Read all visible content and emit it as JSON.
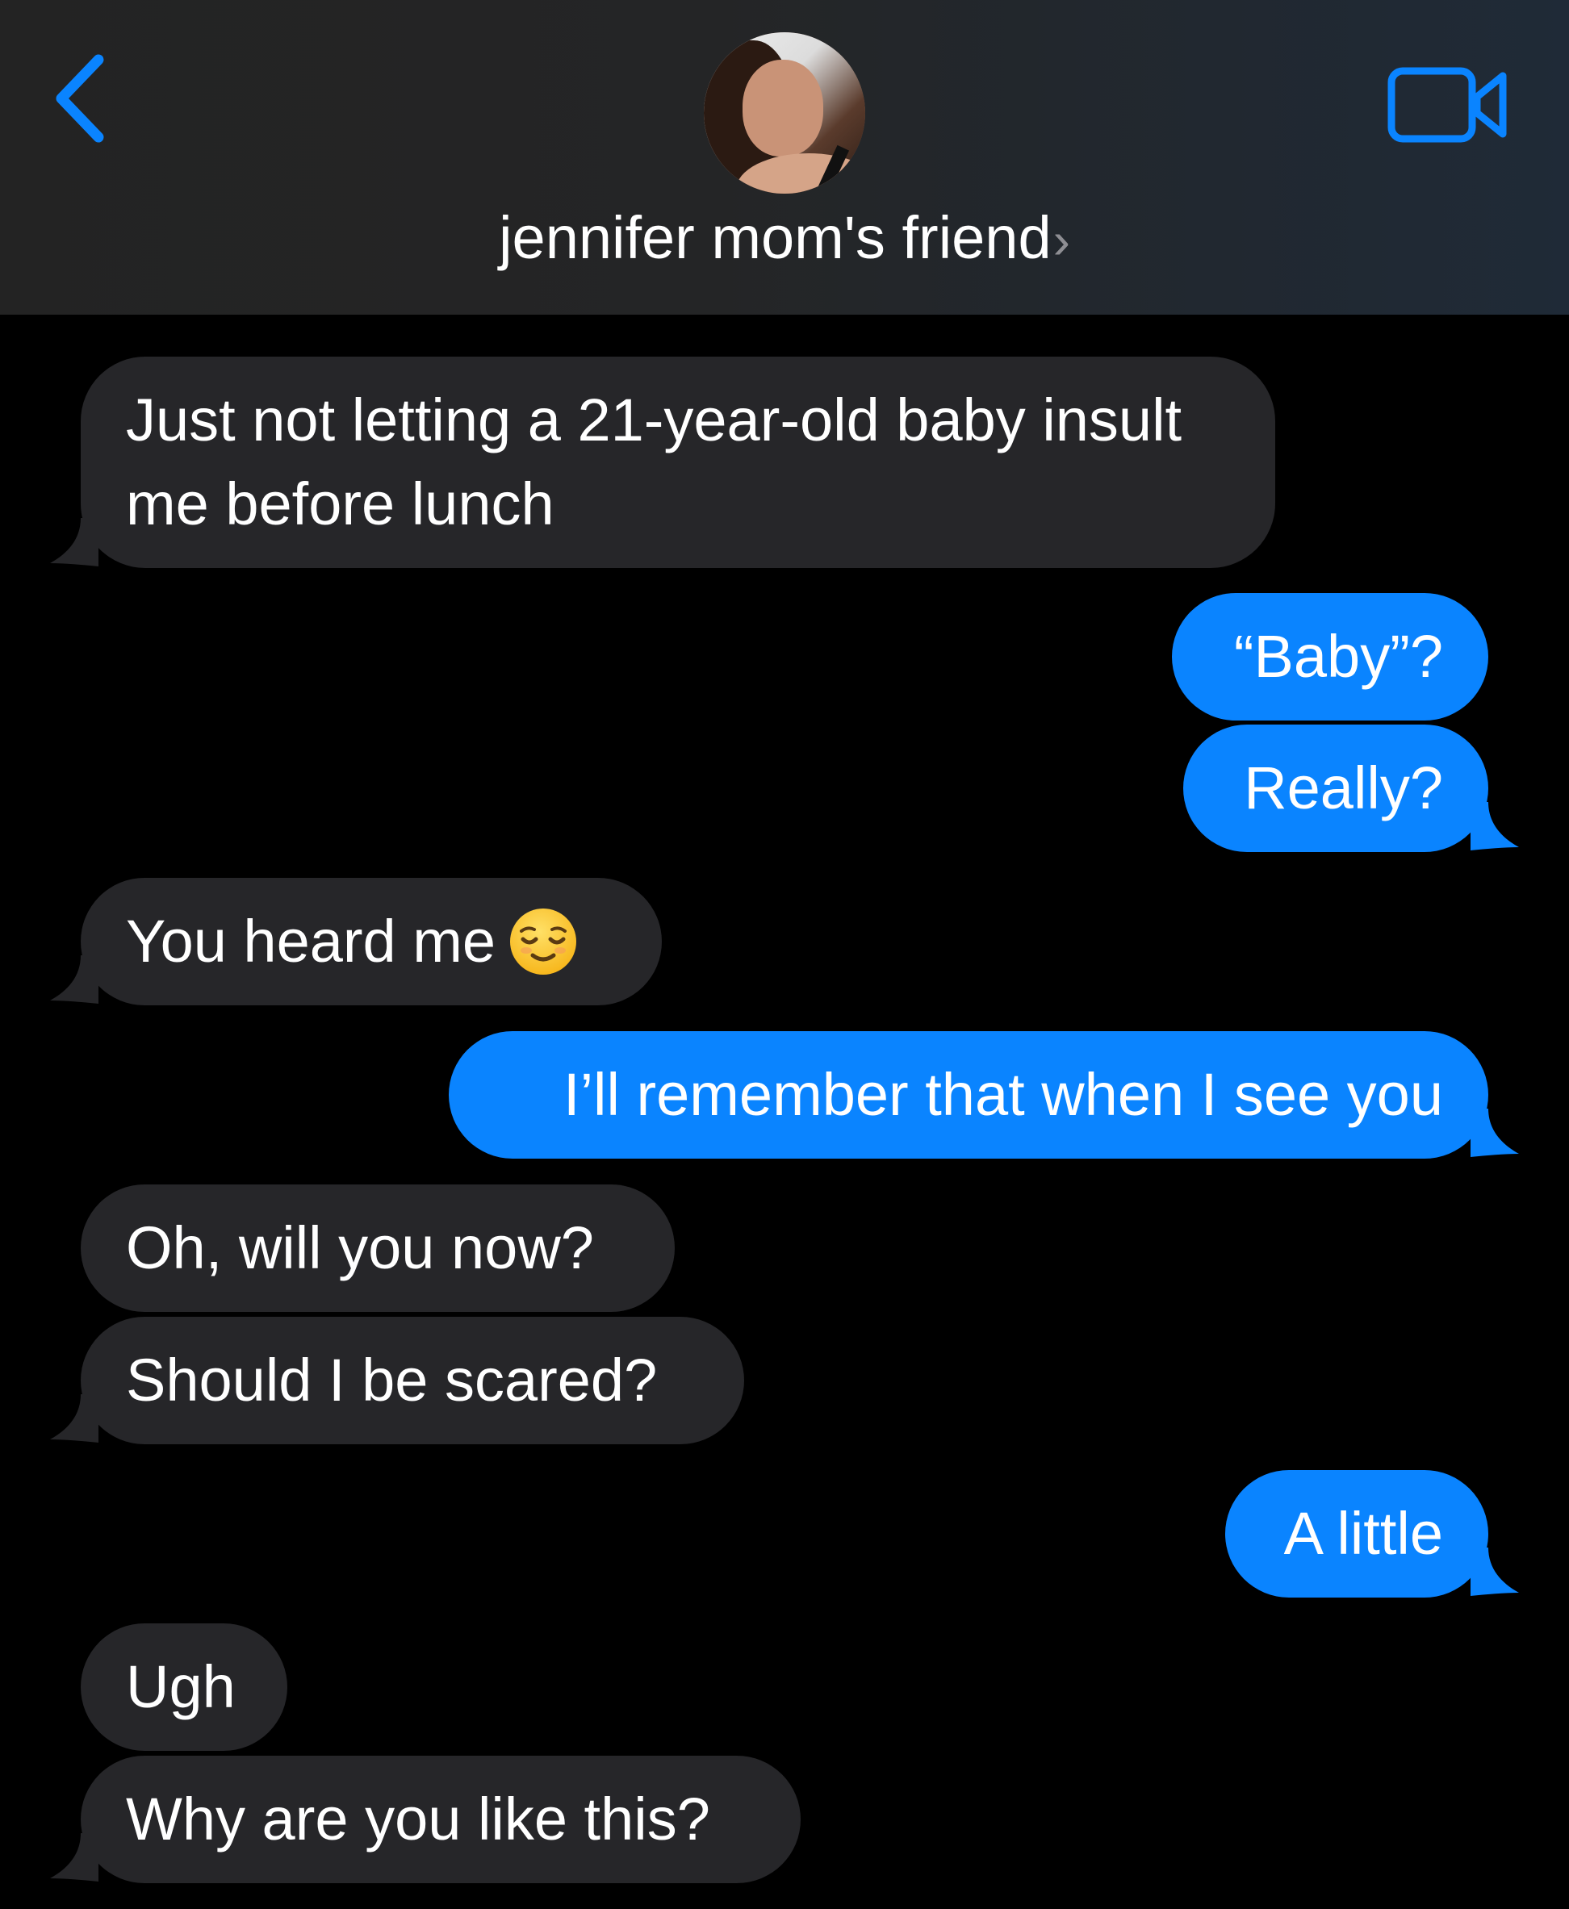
{
  "header": {
    "contact_name": "jennifer mom's friend",
    "chevron": "›",
    "back_icon": "chevron-left-icon",
    "video_icon": "video-camera-icon",
    "accent_color": "#0a84ff"
  },
  "messages": [
    {
      "side": "received",
      "text": "Just not letting a 21-year-old baby insult me before lunch"
    },
    {
      "side": "sent",
      "text": "“Baby”?"
    },
    {
      "side": "sent",
      "text": "Really?"
    },
    {
      "side": "received",
      "text": "You heard me",
      "emoji": "relieved-face-emoji"
    },
    {
      "side": "sent",
      "text": "I’ll remember that when I see you"
    },
    {
      "side": "received",
      "text": "Oh, will you now?"
    },
    {
      "side": "received",
      "text": "Should I be scared?"
    },
    {
      "side": "sent",
      "text": "A little"
    },
    {
      "side": "received",
      "text": "Ugh"
    },
    {
      "side": "received",
      "text": "Why are you like this?"
    }
  ],
  "colors": {
    "received_bubble": "#262629",
    "sent_bubble": "#0a84ff",
    "background": "#000000"
  }
}
